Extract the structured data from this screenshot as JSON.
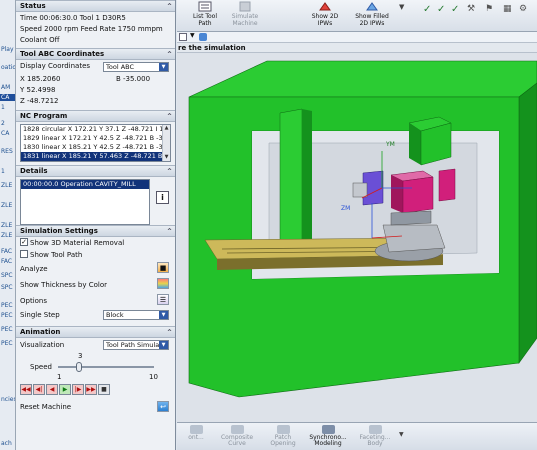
{
  "left_strip": {
    "items": [
      "Play",
      "oatio",
      "AM",
      "CA",
      "1",
      "2",
      "CA",
      "RES",
      "1",
      "ZLE",
      "ZLE",
      "ZLE",
      "ZLE",
      "FAC",
      "FAC",
      "SPC",
      "SPC",
      "PEC",
      "PEC",
      "PEC",
      "PEC",
      "ncies",
      "ach"
    ],
    "selected": "CA"
  },
  "status": {
    "title": "Status",
    "line1": "Time 00:06:30.0 Tool 1   D30R5",
    "line2": "Speed 2000 rpm Feed Rate 1750 mmpm",
    "line3": "Coolant Off"
  },
  "tool_abc": {
    "title": "Tool ABC Coordinates",
    "display_label": "Display Coordinates",
    "display_value": "Tool ABC",
    "x": "X 185.2060",
    "b": "B -35.000",
    "y": "Y 52.4998",
    "z": "Z -48.7212"
  },
  "nc_program": {
    "title": "NC Program",
    "lines": [
      "1828 circular  X 172.21 Y 37.1 Z -48.721 I 1",
      "1829 linear X 172.21 Y 42.5 Z -48.721 B -35",
      "1830 linear X 185.21 Y 42.5 Z -48.721 B -35",
      "1831 linear X 185.21 Y 57.463 Z -48.721 B"
    ],
    "selected_index": 3
  },
  "details": {
    "title": "Details",
    "item": "00:00:00.0 Operation CAVITY_MILL",
    "info_icon": "i"
  },
  "sim_settings": {
    "title": "Simulation Settings",
    "show_3d": "Show 3D Material Removal",
    "show_3d_checked": true,
    "show_tool_path": "Show Tool Path",
    "show_tool_path_checked": false,
    "analyze": "Analyze",
    "thickness": "Show Thickness by Color",
    "options": "Options",
    "single_step": "Single Step",
    "single_step_value": "Block"
  },
  "animation": {
    "title": "Animation",
    "visualization_label": "Visualization",
    "visualization_value": "Tool Path Simulatio",
    "speed_label": "Speed",
    "speed_value": "3",
    "speed_min": "1",
    "speed_max": "10",
    "speed_fraction": 0.22,
    "reset_label": "Reset Machine"
  },
  "ribbon": {
    "list_tool_path": "List Tool\nPath",
    "simulate_machine": "Simulate\nMachine",
    "show_2d_ipws": "Show 2D\nIPWs",
    "show_filled_2d_ipws": "Show Filled\n2D IPWs"
  },
  "hint": "re the simulation",
  "bottom": {
    "items": [
      "ont...",
      "Composite\nCurve",
      "Patch\nOpening",
      "Synchrono...\nModeling",
      "Faceting...\nBody"
    ]
  },
  "scene": {
    "labels": {
      "ym": "YM",
      "zm": "ZM"
    },
    "colors": {
      "enclosure": "#22c12a",
      "enclosure_dark": "#14921d",
      "tool": "#d11f7b",
      "table": "#c9b85a"
    }
  }
}
